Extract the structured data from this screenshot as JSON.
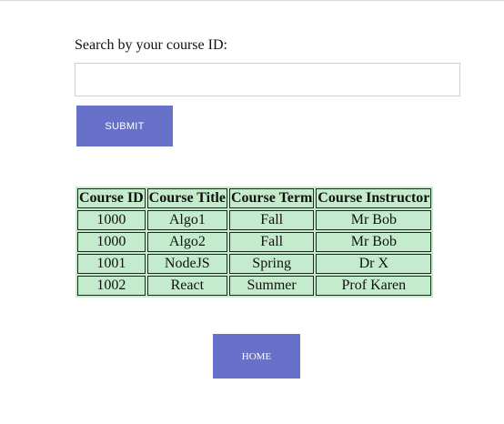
{
  "search": {
    "label": "Search by your course ID:",
    "value": "",
    "placeholder": ""
  },
  "buttons": {
    "submit": "SUBMIT",
    "home": "HOME"
  },
  "table": {
    "headers": [
      "Course ID",
      "Course Title",
      "Course Term",
      "Course Instructor"
    ],
    "rows": [
      [
        "1000",
        "Algo1",
        "Fall",
        "Mr Bob"
      ],
      [
        "1000",
        "Algo2",
        "Fall",
        "Mr Bob"
      ],
      [
        "1001",
        "NodeJS",
        "Spring",
        "Dr X"
      ],
      [
        "1002",
        "React",
        "Summer",
        "Prof Karen"
      ]
    ]
  },
  "colors": {
    "button": "#6771c9",
    "table_bg": "#c4eccc"
  }
}
